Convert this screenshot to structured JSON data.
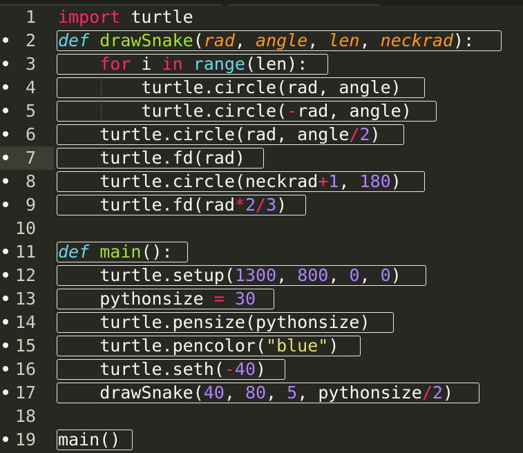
{
  "editor": {
    "theme": "monokai",
    "colors": {
      "background": "#272822",
      "keyword": "#f92672",
      "def_keyword": "#66d9ef",
      "function_name": "#a6e22e",
      "parameter": "#fd971f",
      "builtin": "#66d9ef",
      "number": "#ae81ff",
      "string": "#e6db74",
      "plain": "#f8f8f2"
    },
    "active_line": 7,
    "lines": [
      {
        "number": "1",
        "modified": false,
        "tokens": [
          {
            "t": "import",
            "c": "kw"
          },
          {
            "t": " turtle",
            "c": "pl"
          }
        ]
      },
      {
        "number": "2",
        "modified": true,
        "tokens": [
          {
            "t": "def",
            "c": "dk"
          },
          {
            "t": " ",
            "c": "pl"
          },
          {
            "t": "drawSnake",
            "c": "fn"
          },
          {
            "t": "(",
            "c": "pl"
          },
          {
            "t": "rad",
            "c": "pa"
          },
          {
            "t": ", ",
            "c": "pl"
          },
          {
            "t": "angle",
            "c": "pa"
          },
          {
            "t": ", ",
            "c": "pl"
          },
          {
            "t": "len",
            "c": "pa"
          },
          {
            "t": ", ",
            "c": "pl"
          },
          {
            "t": "neckrad",
            "c": "pa"
          },
          {
            "t": "):",
            "c": "pl"
          }
        ]
      },
      {
        "number": "3",
        "modified": true,
        "tokens": [
          {
            "t": "    ",
            "c": "pl"
          },
          {
            "t": "for",
            "c": "kw"
          },
          {
            "t": " i ",
            "c": "pl"
          },
          {
            "t": "in",
            "c": "kw"
          },
          {
            "t": " ",
            "c": "pl"
          },
          {
            "t": "range",
            "c": "bi"
          },
          {
            "t": "(len):",
            "c": "pl"
          }
        ]
      },
      {
        "number": "4",
        "modified": true,
        "tokens": [
          {
            "t": "        turtle.circle(rad, angle)",
            "c": "pl"
          }
        ]
      },
      {
        "number": "5",
        "modified": true,
        "tokens": [
          {
            "t": "        turtle.circle(",
            "c": "pl"
          },
          {
            "t": "-",
            "c": "op"
          },
          {
            "t": "rad, angle)",
            "c": "pl"
          }
        ]
      },
      {
        "number": "6",
        "modified": true,
        "tokens": [
          {
            "t": "    turtle.circle(rad, angle",
            "c": "pl"
          },
          {
            "t": "/",
            "c": "op"
          },
          {
            "t": "2",
            "c": "nu"
          },
          {
            "t": ")",
            "c": "pl"
          }
        ]
      },
      {
        "number": "7",
        "modified": true,
        "tokens": [
          {
            "t": "    turtle.fd(rad)",
            "c": "pl"
          }
        ]
      },
      {
        "number": "8",
        "modified": true,
        "tokens": [
          {
            "t": "    turtle.circle(neckrad",
            "c": "pl"
          },
          {
            "t": "+",
            "c": "op"
          },
          {
            "t": "1",
            "c": "nu"
          },
          {
            "t": ", ",
            "c": "pl"
          },
          {
            "t": "180",
            "c": "nu"
          },
          {
            "t": ")",
            "c": "pl"
          }
        ]
      },
      {
        "number": "9",
        "modified": true,
        "tokens": [
          {
            "t": "    turtle.fd(rad",
            "c": "pl"
          },
          {
            "t": "*",
            "c": "op"
          },
          {
            "t": "2",
            "c": "nu"
          },
          {
            "t": "/",
            "c": "op"
          },
          {
            "t": "3",
            "c": "nu"
          },
          {
            "t": ")",
            "c": "pl"
          }
        ]
      },
      {
        "number": "10",
        "modified": false,
        "tokens": []
      },
      {
        "number": "11",
        "modified": true,
        "tokens": [
          {
            "t": "def",
            "c": "dk"
          },
          {
            "t": " ",
            "c": "pl"
          },
          {
            "t": "main",
            "c": "fn"
          },
          {
            "t": "():",
            "c": "pl"
          }
        ]
      },
      {
        "number": "12",
        "modified": true,
        "tokens": [
          {
            "t": "    turtle.setup(",
            "c": "pl"
          },
          {
            "t": "1300",
            "c": "nu"
          },
          {
            "t": ", ",
            "c": "pl"
          },
          {
            "t": "800",
            "c": "nu"
          },
          {
            "t": ", ",
            "c": "pl"
          },
          {
            "t": "0",
            "c": "nu"
          },
          {
            "t": ", ",
            "c": "pl"
          },
          {
            "t": "0",
            "c": "nu"
          },
          {
            "t": ")",
            "c": "pl"
          }
        ]
      },
      {
        "number": "13",
        "modified": true,
        "tokens": [
          {
            "t": "    pythonsize ",
            "c": "pl"
          },
          {
            "t": "=",
            "c": "op"
          },
          {
            "t": " ",
            "c": "pl"
          },
          {
            "t": "30",
            "c": "nu"
          }
        ]
      },
      {
        "number": "14",
        "modified": true,
        "tokens": [
          {
            "t": "    turtle.pensize(pythonsize)",
            "c": "pl"
          }
        ]
      },
      {
        "number": "15",
        "modified": true,
        "tokens": [
          {
            "t": "    turtle.pencolor(",
            "c": "pl"
          },
          {
            "t": "\"blue\"",
            "c": "st"
          },
          {
            "t": ")",
            "c": "pl"
          }
        ]
      },
      {
        "number": "16",
        "modified": true,
        "tokens": [
          {
            "t": "    turtle.seth(",
            "c": "pl"
          },
          {
            "t": "-",
            "c": "op"
          },
          {
            "t": "40",
            "c": "nu"
          },
          {
            "t": ")",
            "c": "pl"
          }
        ]
      },
      {
        "number": "17",
        "modified": true,
        "tokens": [
          {
            "t": "    drawSnake(",
            "c": "pl"
          },
          {
            "t": "40",
            "c": "nu"
          },
          {
            "t": ", ",
            "c": "pl"
          },
          {
            "t": "80",
            "c": "nu"
          },
          {
            "t": ", ",
            "c": "pl"
          },
          {
            "t": "5",
            "c": "nu"
          },
          {
            "t": ", pythonsize",
            "c": "pl"
          },
          {
            "t": "/",
            "c": "op"
          },
          {
            "t": "2",
            "c": "nu"
          },
          {
            "t": ")",
            "c": "pl"
          }
        ]
      },
      {
        "number": "18",
        "modified": false,
        "tokens": []
      },
      {
        "number": "19",
        "modified": true,
        "tokens": [
          {
            "t": "main()",
            "c": "pl"
          }
        ]
      }
    ]
  }
}
